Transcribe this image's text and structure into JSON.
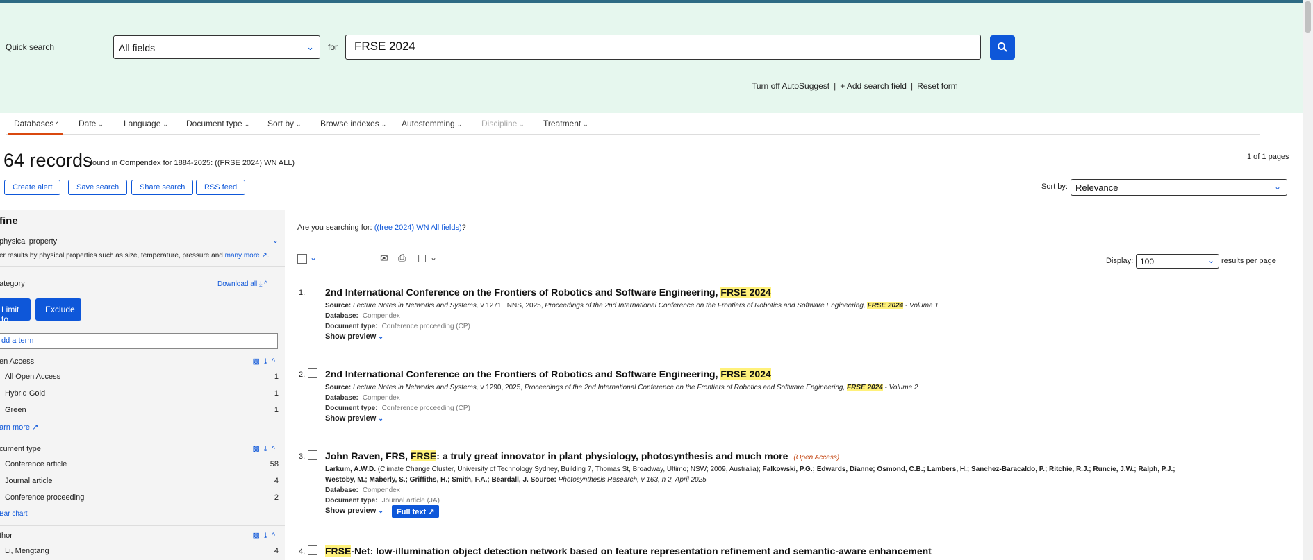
{
  "quick_search": {
    "label": "Quick search",
    "field": "All fields",
    "for_label": "for",
    "query": "FRSE 2024",
    "links": [
      "Turn off AutoSuggest",
      "+ Add search field",
      "Reset form"
    ]
  },
  "tabs": [
    "Databases",
    "Date",
    "Language",
    "Document type",
    "Sort by",
    "Browse indexes",
    "Autostemming",
    "Discipline",
    "Treatment"
  ],
  "summary": {
    "count": "64 records",
    "found": "found in Compendex for 1884-2025: ((FRSE 2024) WN ALL)",
    "pages": "1 of 1 pages"
  },
  "actions": [
    "Create alert",
    "Save search",
    "Share search",
    "RSS feed"
  ],
  "sort": {
    "label": "Sort by:",
    "value": "Relevance"
  },
  "refine": {
    "title": "fine",
    "physical": {
      "heading": "physical property",
      "desc": "er results by physical properties such as size, temperature, pressure and",
      "link": "many more"
    },
    "category": "ategory",
    "download_all": "Download all",
    "limit": "Limit to",
    "exclude": "Exclude",
    "add_term": "dd a term",
    "open_access": {
      "heading": "en Access",
      "items": [
        {
          "label": "All Open Access",
          "count": "1"
        },
        {
          "label": "Hybrid Gold",
          "count": "1"
        },
        {
          "label": "Green",
          "count": "1"
        }
      ],
      "more": "arn more"
    },
    "doc_type": {
      "heading": "cument type",
      "items": [
        {
          "label": "Conference article",
          "count": "58"
        },
        {
          "label": "Journal article",
          "count": "4"
        },
        {
          "label": "Conference proceeding",
          "count": "2"
        }
      ],
      "more": "Bar chart"
    },
    "author": {
      "heading": "thor",
      "items": [
        {
          "label": "Li, Mengtang",
          "count": "4"
        }
      ]
    }
  },
  "suggest": {
    "prefix": "Are you searching for:",
    "link": "((free 2024) WN All fields)",
    "suffix": "?"
  },
  "display": {
    "label": "Display:",
    "value": "100",
    "suffix": "results per page"
  },
  "results": [
    {
      "num": "1.",
      "title_a": "2nd International Conference on the Frontiers of Robotics and Software Engineering,",
      "title_hl": "FRSE 2024",
      "source_label": "Source:",
      "source_a": "Lecture Notes in Networks and Systems,",
      "source_b": "v 1271 LNNS, 2025,",
      "source_c": "Proceedings of the 2nd International Conference on the Frontiers of Robotics and Software Engineering,",
      "source_hl": "FRSE 2024",
      "source_d": "- Volume 1",
      "db_label": "Database:",
      "db": "Compendex",
      "dt_label": "Document type:",
      "dt": "Conference proceeding (CP)",
      "preview": "Show preview"
    },
    {
      "num": "2.",
      "title_a": "2nd International Conference on the Frontiers of Robotics and Software Engineering,",
      "title_hl": "FRSE 2024",
      "source_label": "Source:",
      "source_a": "Lecture Notes in Networks and Systems,",
      "source_b": "v 1290, 2025,",
      "source_c": "Proceedings of the 2nd International Conference on the Frontiers of Robotics and Software Engineering,",
      "source_hl": "FRSE 2024",
      "source_d": "- Volume 2",
      "db_label": "Database:",
      "db": "Compendex",
      "dt_label": "Document type:",
      "dt": "Conference proceeding (CP)",
      "preview": "Show preview"
    },
    {
      "num": "3.",
      "title_a": "John Raven, FRS,",
      "title_hl": "FRSE",
      "title_b": ": a truly great innovator in plant physiology, photosynthesis and much more",
      "oa": "(Open Access)",
      "authors_1": "Larkum, A.W.D.",
      "authors_2": "(Climate Change Cluster, University of Technology Sydney, Building 7, Thomas St, Broadway, Ultimo; NSW; 2009, Australia);",
      "authors_3": "Falkowski, P.G.; Edwards, Dianne; Osmond, C.B.; Lambers, H.; Sanchez-Baracaldo, P.; Ritchie, R.J.; Runcie, J.W.; Ralph, P.J.;",
      "authors_4": "Westoby, M.; Maberly, S.; Griffiths, H.; Smith, F.A.; Beardall, J.",
      "source_label": "Source:",
      "source_a": "Photosynthesis Research,",
      "source_b": "v 163, n 2, April 2025",
      "db_label": "Database:",
      "db": "Compendex",
      "dt_label": "Document type:",
      "dt": "Journal article (JA)",
      "preview": "Show preview",
      "fulltext": "Full text"
    },
    {
      "num": "4.",
      "title_hl": "FRSE",
      "title_b": "-Net: low-illumination object detection network based on feature representation refinement and semantic-aware enhancement"
    }
  ]
}
